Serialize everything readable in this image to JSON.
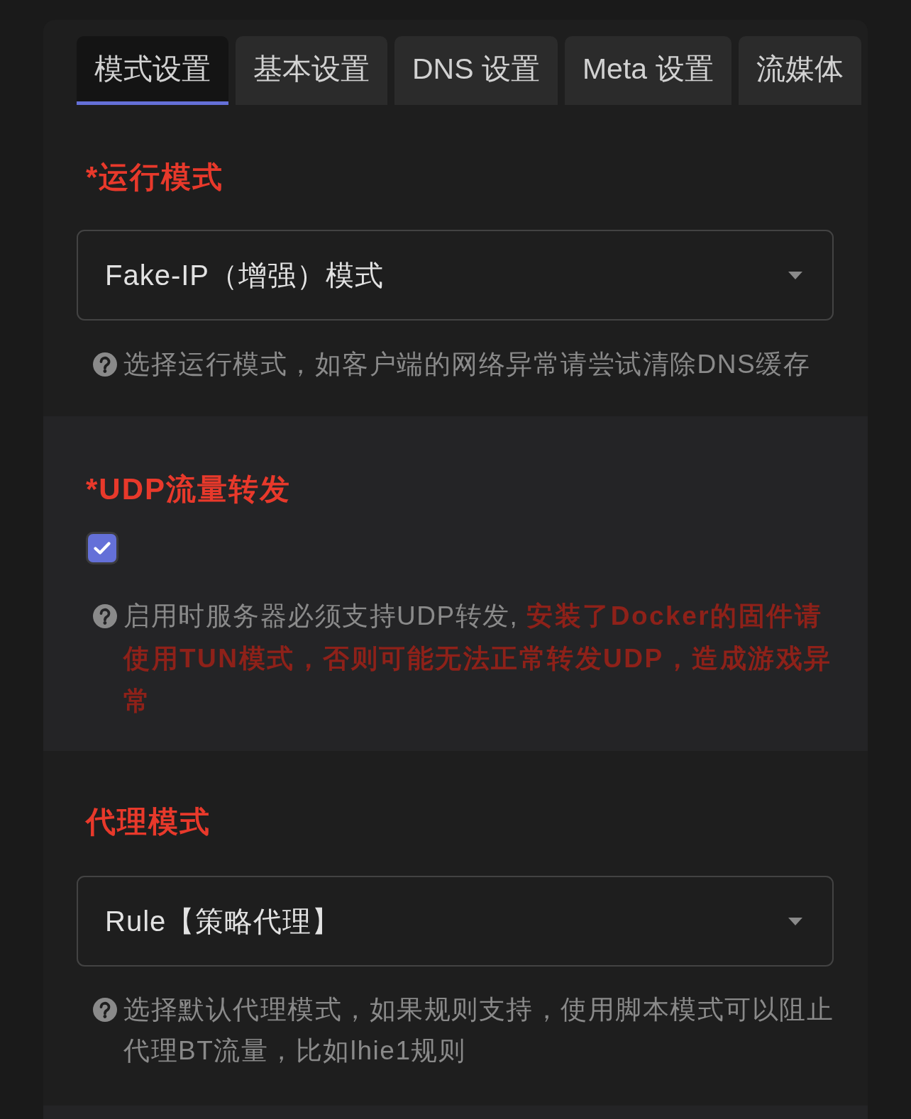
{
  "tabs": [
    {
      "label": "模式设置",
      "selected": true
    },
    {
      "label": "基本设置",
      "selected": false
    },
    {
      "label": "DNS 设置",
      "selected": false
    },
    {
      "label": "Meta 设置",
      "selected": false
    },
    {
      "label": "流媒体",
      "selected": false
    }
  ],
  "sections": [
    {
      "kind": "select",
      "label": "*运行模式",
      "value": "Fake-IP（增强）模式",
      "help": "选择运行模式，如客户端的网络异常请尝试清除DNS缓存"
    },
    {
      "kind": "checkbox",
      "label": "*UDP流量转发",
      "checked": true,
      "help": "启用时服务器必须支持UDP转发, ",
      "warning": "安装了Docker的固件请使用TUN模式，否则可能无法正常转发UDP，造成游戏异常"
    },
    {
      "kind": "select",
      "label": "代理模式",
      "value": "Rule【策略代理】",
      "help": "选择默认代理模式，如果规则支持，使用脚本模式可以阻止代理BT流量，比如lhie1规则"
    }
  ]
}
